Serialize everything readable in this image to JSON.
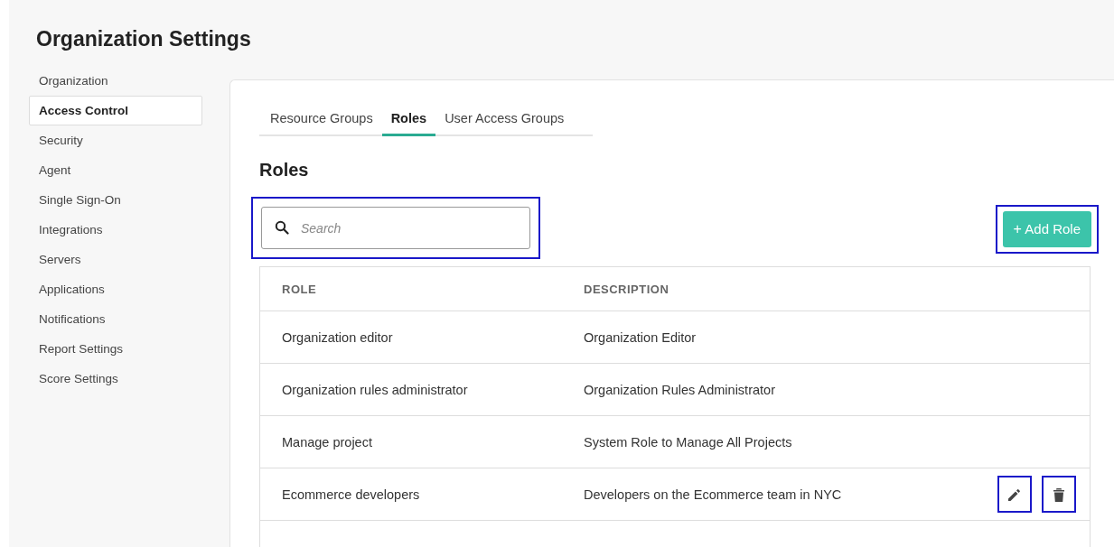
{
  "page": {
    "title": "Organization Settings"
  },
  "sidebar": {
    "items": [
      {
        "label": "Organization",
        "selected": false
      },
      {
        "label": "Access Control",
        "selected": true
      },
      {
        "label": "Security",
        "selected": false
      },
      {
        "label": "Agent",
        "selected": false
      },
      {
        "label": "Single Sign-On",
        "selected": false
      },
      {
        "label": "Integrations",
        "selected": false
      },
      {
        "label": "Servers",
        "selected": false
      },
      {
        "label": "Applications",
        "selected": false
      },
      {
        "label": "Notifications",
        "selected": false
      },
      {
        "label": "Report Settings",
        "selected": false
      },
      {
        "label": "Score Settings",
        "selected": false
      }
    ]
  },
  "tabs": [
    {
      "label": "Resource Groups",
      "selected": false
    },
    {
      "label": "Roles",
      "selected": true
    },
    {
      "label": "User Access Groups",
      "selected": false
    }
  ],
  "section_title": "Roles",
  "search": {
    "placeholder": "Search",
    "highlighted": true
  },
  "add_button": {
    "icon": "+",
    "label": "Add Role",
    "highlighted": true
  },
  "table": {
    "columns": [
      "ROLE",
      "DESCRIPTION"
    ],
    "rows": [
      {
        "cells": [
          "Organization editor",
          "Organization Editor"
        ]
      },
      {
        "cells": [
          "Organization rules administrator",
          "Organization Rules Administrator"
        ]
      },
      {
        "cells": [
          "Manage project",
          "System Role to Manage All Projects"
        ]
      },
      {
        "cells": [
          "Ecommerce developers",
          "Developers on the Ecommerce team in NYC"
        ],
        "actions": [
          {
            "kind": "edit",
            "highlighted": true
          },
          {
            "kind": "delete",
            "highlighted": true
          }
        ]
      }
    ]
  }
}
